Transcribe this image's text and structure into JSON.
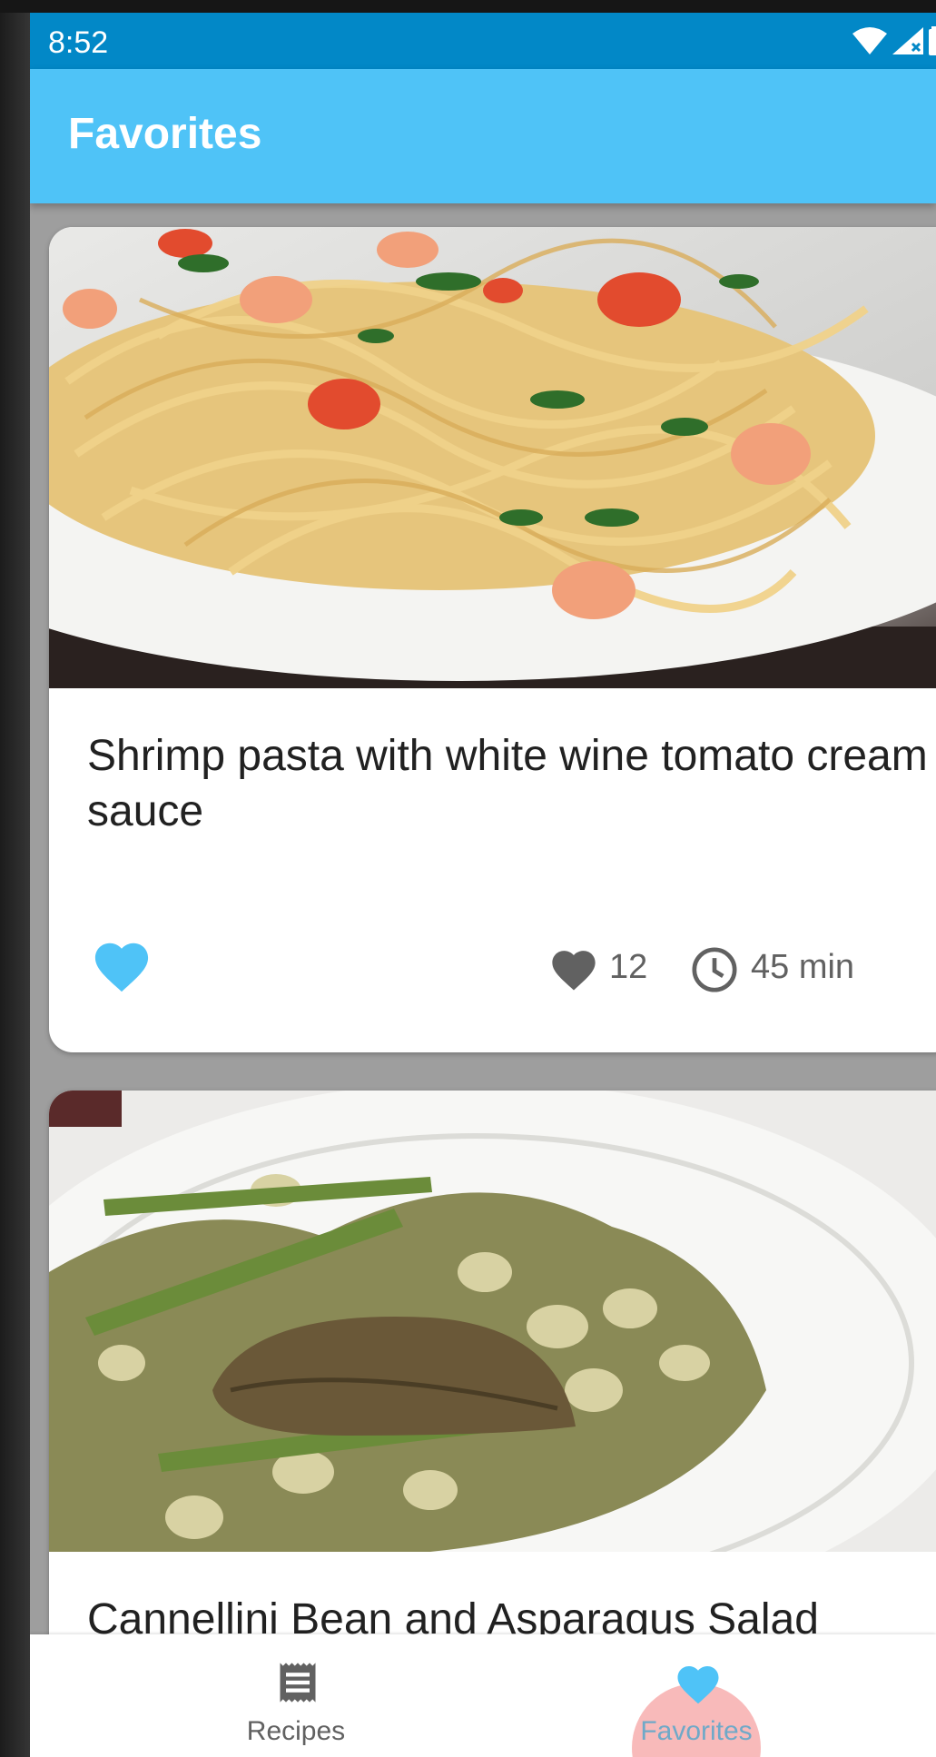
{
  "status_bar": {
    "time": "8:52",
    "icons": [
      "wifi-icon",
      "signal-icon",
      "battery-icon"
    ]
  },
  "app_bar": {
    "title": "Favorites"
  },
  "colors": {
    "status_bar": "#0288c7",
    "app_bar": "#4fc3f7",
    "accent_heart": "#4fc3f7",
    "text_primary": "#212121",
    "text_secondary": "#616161",
    "ripple": "#f38282"
  },
  "recipes": [
    {
      "title": "Shrimp pasta with white wine tomato cream sauce",
      "likes": "12",
      "time": "45 min",
      "favorited": true,
      "image": "shrimp-pasta-photo"
    },
    {
      "title": "Cannellini Bean and Asparagus Salad",
      "image": "bean-asparagus-salad-photo"
    }
  ],
  "bottom_nav": {
    "items": [
      {
        "label": "Recipes",
        "icon": "receipt-icon",
        "selected": false
      },
      {
        "label": "Favorites",
        "icon": "heart-icon",
        "selected": true
      }
    ]
  }
}
